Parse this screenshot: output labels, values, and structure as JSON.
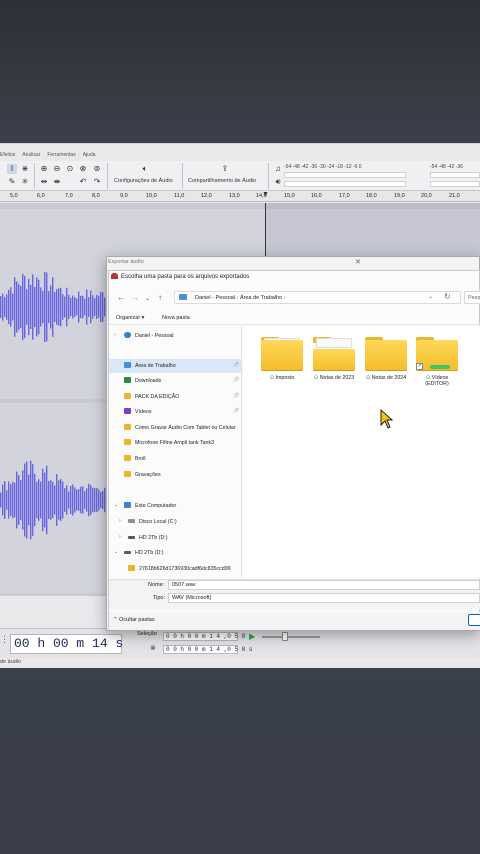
{
  "menubar": {
    "items": [
      "Efeitos",
      "Analisar",
      "Ferramentas",
      "Ajuda"
    ]
  },
  "toolbar": {
    "audio_settings_label": "Configurações de Áudio",
    "share_label": "Compartilhamento de Áudio"
  },
  "meter": {
    "ticks_left": "-54  -48  -42  -36  -30  -24  -18  -12   -6    0",
    "ticks_right": "-54  -48  -42  -36"
  },
  "ruler": {
    "ticks": [
      "5,0",
      "6,0",
      "7,0",
      "8,0",
      "9,0",
      "10,0",
      "11,0",
      "12,0",
      "13,0",
      "14,0",
      "15,0",
      "16,0",
      "17,0",
      "18,0",
      "19,0",
      "20,0",
      "21,0"
    ]
  },
  "selection": {
    "timecode": "00 h 00 m 14 s",
    "label": "Seleção",
    "start": "0 0 h 0 0 m 1 4 ,0 5 8 s",
    "end": "0 0 h 0 0 m 1 4 ,0 5 8 s"
  },
  "status": {
    "text": "de áudio"
  },
  "dialog": {
    "title": "Exportar áudio",
    "subtitle": "Escolha uma pasta para os arquivos exportados",
    "address": {
      "parts": [
        "Daniel - Pessoal",
        "Área de Trabalho"
      ]
    },
    "search_placeholder": "Pesq",
    "commands": {
      "organize": "Organizar ▾",
      "new_folder": "Nova pasta"
    },
    "nav_items": [
      {
        "label": "Daniel - Pessoal",
        "type": "cloud"
      },
      {
        "label": "Área de Trabalho",
        "type": "desktop",
        "selected": true
      },
      {
        "label": "Downloads",
        "type": "download"
      },
      {
        "label": "PACK DA EDIÇÃO",
        "type": "folder"
      },
      {
        "label": "Vídeos",
        "type": "video"
      },
      {
        "label": "Como Gravar Áudio Com Tablet ou Celular",
        "type": "folder"
      },
      {
        "label": "Microfone Fifine Ampli tank Tank3",
        "type": "folder"
      },
      {
        "label": "Broll",
        "type": "folder"
      },
      {
        "label": "Gravações",
        "type": "folder"
      },
      {
        "label": "Este Computador",
        "type": "pc"
      },
      {
        "label": "Disco Local (C:)",
        "type": "drive"
      },
      {
        "label": "HD 2Tb (D:)",
        "type": "drive"
      },
      {
        "label": "HD 2Tb (D:)",
        "type": "drive"
      },
      {
        "label": "27618b626d1736930cadf6dc835ccd99",
        "type": "folder"
      }
    ],
    "folders": [
      {
        "name": "Imposto",
        "sync": "⊙"
      },
      {
        "name": "Notas de 2023",
        "sync": "⊙"
      },
      {
        "name": "Notas de 2024",
        "sync": "⊙"
      },
      {
        "name": "Vídeos (EDITOR)",
        "sync": "⊙"
      }
    ],
    "filename_label": "Nome:",
    "filename_value": "0507.wav",
    "type_label": "Tipo:",
    "type_value": "WAV (Microsoft)",
    "hide_folders": "Ocultar pastas"
  },
  "colors": {
    "waveform": "#3d3ad6",
    "accent": "#0067c0",
    "folder": "#f4bd2a"
  }
}
